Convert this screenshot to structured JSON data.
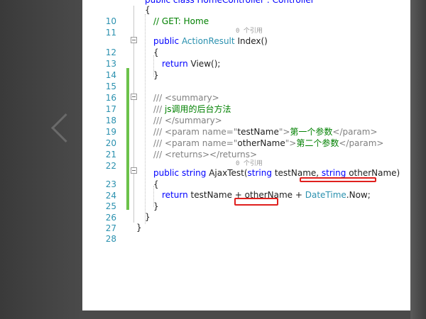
{
  "editor": {
    "header_fragment": "public class HomeController : Controller",
    "reference_hint": "0 个引用",
    "lines": [
      {
        "no": "10",
        "text": "{"
      },
      {
        "no": "11",
        "text": "// GET: Home"
      },
      {
        "no": "12",
        "kw": "public",
        "type": "ActionResult",
        "rest": "Index()"
      },
      {
        "no": "13",
        "text": "{"
      },
      {
        "no": "14",
        "kw": "return",
        "rest": "View();"
      },
      {
        "no": "15",
        "text": "}"
      },
      {
        "no": "16",
        "text": ""
      },
      {
        "no": "17",
        "text": "/// <summary>"
      },
      {
        "no": "18",
        "prefix": "/// ",
        "cn": "js调用的后台方法"
      },
      {
        "no": "19",
        "text": "/// </summary>"
      },
      {
        "no": "20",
        "prefix": "/// <param name=\"",
        "pname": "testName",
        "mid": "\">",
        "cn": "第一个参数",
        "end": "</param>"
      },
      {
        "no": "21",
        "prefix": "/// <param name=\"",
        "pname": "otherName",
        "mid": "\">",
        "cn": "第二个参数",
        "end": "</param>"
      },
      {
        "no": "22",
        "text": "/// <returns></returns>"
      },
      {
        "no": "23",
        "kw": "public",
        "kw2": "string",
        "name": "AjaxTest(",
        "kw3": "string",
        "p1": "testName,",
        "kw4": "string",
        "p2": "otherName)"
      },
      {
        "no": "24",
        "text": "{"
      },
      {
        "no": "25",
        "kw": "return",
        "p1": "testName + otherName +",
        "type": "DateTime",
        "rest": ".Now;"
      },
      {
        "no": "26",
        "text": "}"
      },
      {
        "no": "27",
        "text": "}"
      },
      {
        "no": "28",
        "text": "}"
      }
    ]
  },
  "colors": {
    "keyword": "#0000ff",
    "type": "#2b91af",
    "comment": "#008000",
    "line_number": "#2b91af",
    "change_marker": "#6cc24a",
    "annotation_red": "#e0201e"
  }
}
